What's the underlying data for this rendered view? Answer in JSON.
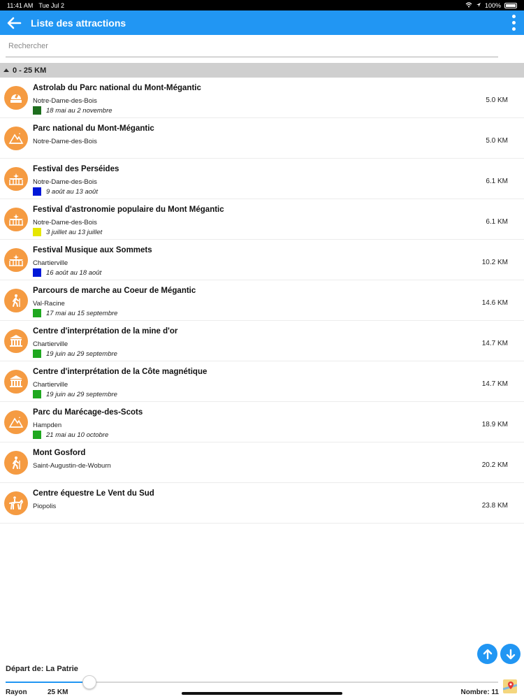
{
  "status": {
    "time": "11:41 AM",
    "date": "Tue Jul 2",
    "battery": "100%"
  },
  "header": {
    "title": "Liste des attractions"
  },
  "search": {
    "placeholder": "Rechercher"
  },
  "section": {
    "label": "0 - 25 KM"
  },
  "items": [
    {
      "name": "Astrolab du Parc national du Mont-Mégantic",
      "city": "Notre-Dame-des-Bois",
      "dates": "18 mai au 2 novembre",
      "color": "#1e6e1e",
      "distance": "5.0 KM",
      "icon": "observatory-icon"
    },
    {
      "name": "Parc national du Mont-Mégantic",
      "city": "Notre-Dame-des-Bois",
      "dates": "",
      "color": "",
      "distance": "5.0 KM",
      "icon": "mountain-park-icon"
    },
    {
      "name": "Festival des Perséides",
      "city": "Notre-Dame-des-Bois",
      "dates": "9 août au 13 août",
      "color": "#0018d8",
      "distance": "6.1 KM",
      "icon": "festival-icon"
    },
    {
      "name": "Festival d'astronomie populaire du Mont Mégantic",
      "city": "Notre-Dame-des-Bois",
      "dates": "3 juillet au 13 juillet",
      "color": "#e6e600",
      "distance": "6.1 KM",
      "icon": "festival-icon"
    },
    {
      "name": "Festival Musique aux Sommets",
      "city": "Chartierville",
      "dates": "16 août au 18 août",
      "color": "#0018d8",
      "distance": "10.2 KM",
      "icon": "festival-icon"
    },
    {
      "name": "Parcours de marche au Coeur de Mégantic",
      "city": "Val-Racine",
      "dates": "17 mai au 15 septembre",
      "color": "#1fa81f",
      "distance": "14.6 KM",
      "icon": "hiker-icon"
    },
    {
      "name": "Centre d'interprétation de la mine d'or",
      "city": "Chartierville",
      "dates": "19 juin au 29 septembre",
      "color": "#1fa81f",
      "distance": "14.7 KM",
      "icon": "museum-icon"
    },
    {
      "name": "Centre d'interprétation de la Côte magnétique",
      "city": "Chartierville",
      "dates": "19 juin au 29 septembre",
      "color": "#1fa81f",
      "distance": "14.7 KM",
      "icon": "museum-icon"
    },
    {
      "name": "Parc du Marécage-des-Scots",
      "city": "Hampden",
      "dates": "21 mai au 10 octobre",
      "color": "#1fa81f",
      "distance": "18.9 KM",
      "icon": "mountain-park-icon"
    },
    {
      "name": "Mont Gosford",
      "city": "Saint-Augustin-de-Woburn",
      "dates": "",
      "color": "",
      "distance": "20.2 KM",
      "icon": "hiker-icon"
    },
    {
      "name": "Centre équestre Le Vent du Sud",
      "city": "Piopolis",
      "dates": "",
      "color": "",
      "distance": "23.8 KM",
      "icon": "horse-rider-icon"
    }
  ],
  "footer": {
    "depart": "Départ de: La Patrie",
    "rayon_label": "Rayon",
    "rayon_value": "25 KM",
    "slider_fraction": 0.17,
    "nombre": "Nombre: 11"
  },
  "colors": {
    "accent": "#2196f3",
    "icon_bg": "#f59b42",
    "section_bg": "#cfcfcf"
  }
}
